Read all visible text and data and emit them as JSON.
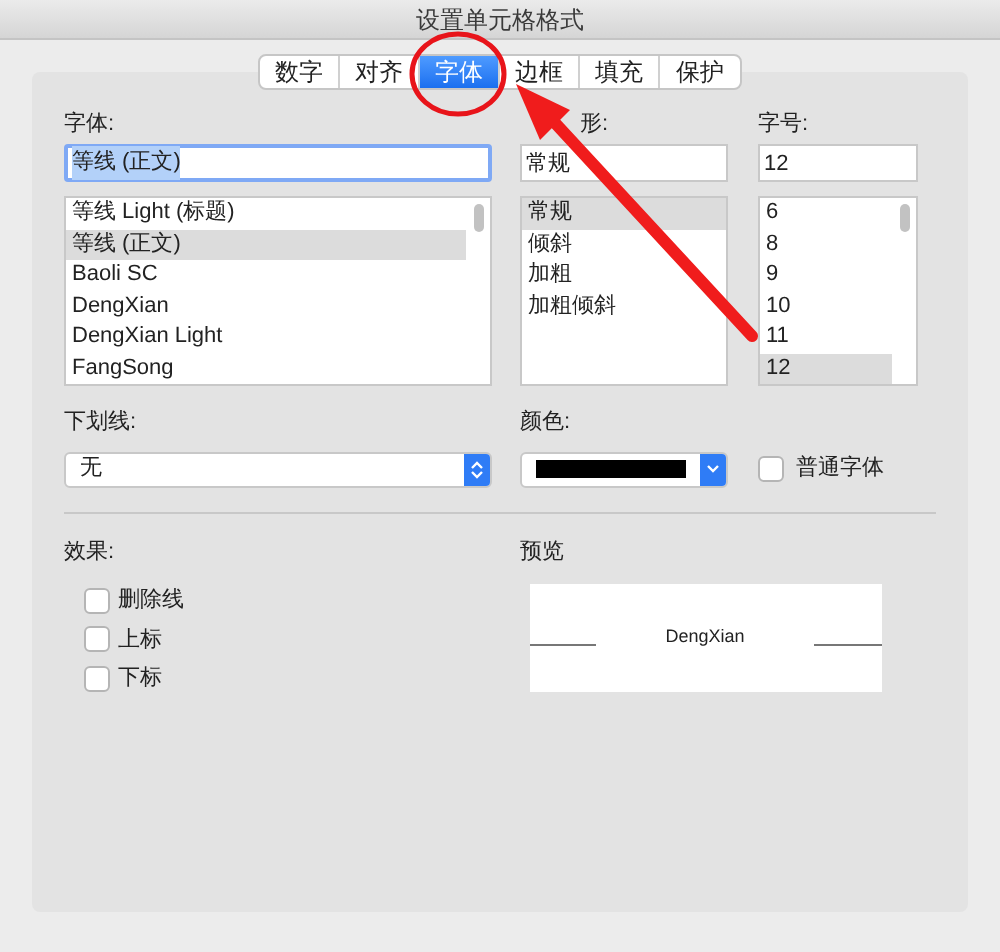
{
  "window": {
    "title": "设置单元格格式"
  },
  "tabs": [
    {
      "label": "数字",
      "selected": false
    },
    {
      "label": "对齐",
      "selected": false
    },
    {
      "label": "字体",
      "selected": true
    },
    {
      "label": "边框",
      "selected": false
    },
    {
      "label": "填充",
      "selected": false
    },
    {
      "label": "保护",
      "selected": false
    }
  ],
  "font": {
    "label": "字体:",
    "value": "等线 (正文)",
    "items": [
      {
        "label": "等线 Light (标题)",
        "selected": false
      },
      {
        "label": "等线 (正文)",
        "selected": true
      },
      {
        "label": "Baoli SC",
        "selected": false
      },
      {
        "label": "DengXian",
        "selected": false
      },
      {
        "label": "DengXian Light",
        "selected": false
      },
      {
        "label": "FangSong",
        "selected": false
      }
    ]
  },
  "style": {
    "label": "形:",
    "value": "常规",
    "items": [
      {
        "label": "常规",
        "selected": true
      },
      {
        "label": "倾斜",
        "selected": false
      },
      {
        "label": "加粗",
        "selected": false
      },
      {
        "label": "加粗倾斜",
        "selected": false
      }
    ]
  },
  "size": {
    "label": "字号:",
    "value": "12",
    "items": [
      {
        "label": "6",
        "selected": false
      },
      {
        "label": "8",
        "selected": false
      },
      {
        "label": "9",
        "selected": false
      },
      {
        "label": "10",
        "selected": false
      },
      {
        "label": "11",
        "selected": false
      },
      {
        "label": "12",
        "selected": true
      }
    ]
  },
  "underline": {
    "label": "下划线:",
    "value": "无"
  },
  "color": {
    "label": "颜色:",
    "color": "#000000"
  },
  "normal_font": {
    "label": "普通字体",
    "checked": false
  },
  "effects": {
    "label": "效果:",
    "items": [
      {
        "label": "删除线",
        "checked": false
      },
      {
        "label": "上标",
        "checked": false
      },
      {
        "label": "下标",
        "checked": false
      }
    ]
  },
  "preview": {
    "label": "预览",
    "text": "DengXian"
  }
}
